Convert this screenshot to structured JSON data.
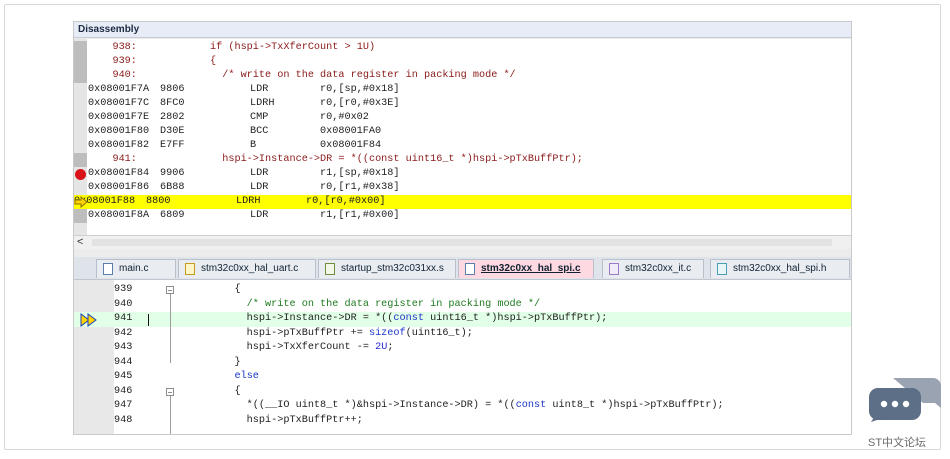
{
  "disassembly": {
    "title": "Disassembly",
    "lines": [
      {
        "type": "src",
        "num": "938:",
        "code": "if (hspi->TxXferCount > 1U)"
      },
      {
        "type": "src",
        "num": "939:",
        "code": "{"
      },
      {
        "type": "src",
        "num": "940:",
        "code": "  /* write on the data register in packing mode */"
      },
      {
        "type": "asm",
        "addr": "0x08001F7A",
        "op": "9806",
        "mn": "LDR",
        "args": "r0,[sp,#0x18]"
      },
      {
        "type": "asm",
        "addr": "0x08001F7C",
        "op": "8FC0",
        "mn": "LDRH",
        "args": "r0,[r0,#0x3E]"
      },
      {
        "type": "asm",
        "addr": "0x08001F7E",
        "op": "2802",
        "mn": "CMP",
        "args": "r0,#0x02"
      },
      {
        "type": "asm",
        "addr": "0x08001F80",
        "op": "D30E",
        "mn": "BCC",
        "args": "0x08001FA0"
      },
      {
        "type": "asm",
        "addr": "0x08001F82",
        "op": "E7FF",
        "mn": "B",
        "args": "0x08001F84"
      },
      {
        "type": "src",
        "num": "941:",
        "code": "  hspi->Instance->DR = *((const uint16_t *)hspi->pTxBuffPtr);"
      },
      {
        "type": "asm",
        "addr": "0x08001F84",
        "op": "9906",
        "mn": "LDR",
        "args": "r1,[sp,#0x18]",
        "breakpoint": true
      },
      {
        "type": "asm",
        "addr": "0x08001F86",
        "op": "6B88",
        "mn": "LDR",
        "args": "r0,[r1,#0x38]"
      },
      {
        "type": "asm",
        "addr": "0x08001F88",
        "op": "8800",
        "mn": "LDRH",
        "args": "r0,[r0,#0x00]",
        "current": true
      },
      {
        "type": "asm",
        "addr": "0x08001F8A",
        "op": "6809",
        "mn": "LDR",
        "args": "r1,[r1,#0x00]"
      }
    ],
    "scroll_left_label": "<"
  },
  "tabs": [
    {
      "label": "main.c",
      "icon": "c-file-icon"
    },
    {
      "label": "stm32c0xx_hal_uart.c",
      "icon": "c-file-icon"
    },
    {
      "label": "startup_stm32c031xx.s",
      "icon": "asm-file-icon"
    },
    {
      "label": "stm32c0xx_hal_spi.c",
      "icon": "c-file-icon",
      "active": true
    },
    {
      "label": "stm32c0xx_it.c",
      "icon": "c-file-icon"
    },
    {
      "label": "stm32c0xx_hal_spi.h",
      "icon": "h-file-icon"
    }
  ],
  "editor": {
    "lines": [
      {
        "num": "939",
        "fold": "minus",
        "parts": [
          {
            "t": "    {",
            "c": ""
          }
        ]
      },
      {
        "num": "940",
        "parts": [
          {
            "t": "      /* write on the data register in packing mode */",
            "c": "cm"
          }
        ]
      },
      {
        "num": "941",
        "current": true,
        "parts": [
          {
            "t": "      hspi->Instance->DR = *((",
            "c": ""
          },
          {
            "t": "const",
            "c": "kw"
          },
          {
            "t": " uint16_t *)hspi->pTxBuffPtr);",
            "c": ""
          }
        ]
      },
      {
        "num": "942",
        "parts": [
          {
            "t": "      hspi->pTxBuffPtr += ",
            "c": ""
          },
          {
            "t": "sizeof",
            "c": "kw"
          },
          {
            "t": "(uint16_t);",
            "c": ""
          }
        ]
      },
      {
        "num": "943",
        "parts": [
          {
            "t": "      hspi->TxXferCount -= ",
            "c": ""
          },
          {
            "t": "2U",
            "c": "nm"
          },
          {
            "t": ";",
            "c": ""
          }
        ]
      },
      {
        "num": "944",
        "fold": "end",
        "parts": [
          {
            "t": "    }",
            "c": ""
          }
        ]
      },
      {
        "num": "945",
        "parts": [
          {
            "t": "    ",
            "c": ""
          },
          {
            "t": "else",
            "c": "kw"
          }
        ]
      },
      {
        "num": "946",
        "fold": "minus",
        "parts": [
          {
            "t": "    {",
            "c": ""
          }
        ]
      },
      {
        "num": "947",
        "parts": [
          {
            "t": "      *((__IO uint8_t *)&hspi->Instance->DR) = *((",
            "c": ""
          },
          {
            "t": "const",
            "c": "kw"
          },
          {
            "t": " uint8_t *)hspi->pTxBuffPtr);",
            "c": ""
          }
        ]
      },
      {
        "num": "948",
        "parts": [
          {
            "t": "      hspi->pTxBuffPtr++;",
            "c": ""
          }
        ]
      }
    ]
  },
  "watermark": {
    "caption": "ST中文论坛",
    "icon": "chat-bubble-icon"
  },
  "colors": {
    "current_line": "#ffff00",
    "breakpoint": "#d8141a",
    "editor_current": "#e2ffe7",
    "active_tab": "#ffd9e2"
  }
}
